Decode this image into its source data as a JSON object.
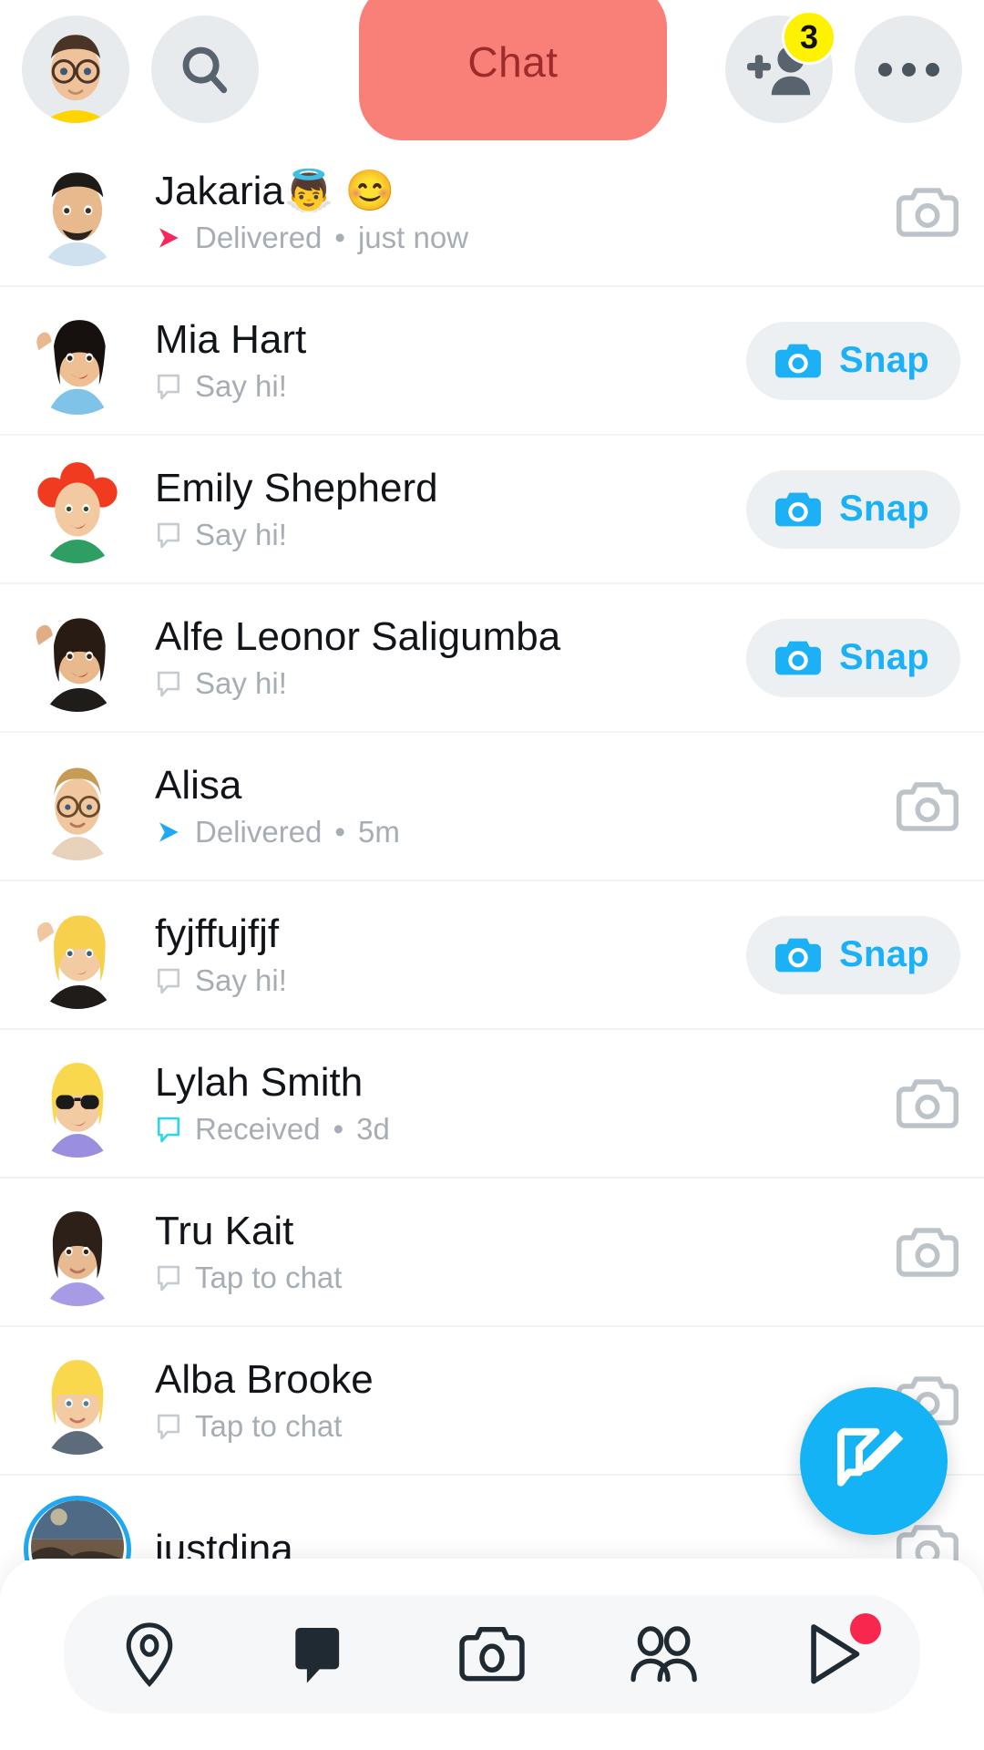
{
  "header": {
    "profile_avatar": "bitmoji-avatar",
    "search_icon": "search-icon",
    "title_pill": {
      "label": "Chat",
      "bg": "#F98079",
      "text_color": "#9E2B2B"
    },
    "add_friend_icon": "add-friend-icon",
    "add_friend_badge": "3",
    "more_icon": "more-options-icon"
  },
  "colors": {
    "snap_blue": "#1CB0F6",
    "fab_blue": "#14B3F5",
    "badge_yellow": "#FFF200",
    "delivered_pink": "#F7275E",
    "delivered_blue": "#1FA9F2",
    "received_cyan": "#2ED6E8",
    "spotlight_red": "#F7274E",
    "muted_text": "#A7ADB4"
  },
  "chats": [
    {
      "name": "Jakaria👼 😊",
      "status": "Delivered",
      "time": "just now",
      "separator": "•",
      "status_icon": "delivered-arrow-icon",
      "status_icon_color": "#F7275E",
      "action": "camera",
      "action_label": "",
      "avatar_style": "bitmoji-male-dark"
    },
    {
      "name": "Mia Hart",
      "status": "Say hi!",
      "time": "",
      "separator": "",
      "status_icon": "chat-bubble-icon",
      "status_icon_color": "#C6CBD0",
      "action": "snap",
      "action_label": "Snap",
      "avatar_style": "bitmoji-black-hair-wave"
    },
    {
      "name": "Emily Shepherd",
      "status": "Say hi!",
      "time": "",
      "separator": "",
      "status_icon": "chat-bubble-icon",
      "status_icon_color": "#C6CBD0",
      "action": "snap",
      "action_label": "Snap",
      "avatar_style": "bitmoji-red-hair"
    },
    {
      "name": "Alfe Leonor Saligumba",
      "status": "Say hi!",
      "time": "",
      "separator": "",
      "status_icon": "chat-bubble-icon",
      "status_icon_color": "#C6CBD0",
      "action": "snap",
      "action_label": "Snap",
      "avatar_style": "bitmoji-brown-hair-wave"
    },
    {
      "name": "Alisa",
      "status": "Delivered",
      "time": "5m",
      "separator": "•",
      "status_icon": "delivered-arrow-icon",
      "status_icon_color": "#1FA9F2",
      "action": "camera",
      "action_label": "",
      "avatar_style": "bitmoji-glasses-blonde"
    },
    {
      "name": "fyjffujfjf",
      "status": "Say hi!",
      "time": "",
      "separator": "",
      "status_icon": "chat-bubble-icon",
      "status_icon_color": "#C6CBD0",
      "action": "snap",
      "action_label": "Snap",
      "avatar_style": "bitmoji-blonde-wave"
    },
    {
      "name": "Lylah Smith",
      "status": "Received",
      "time": "3d",
      "separator": "•",
      "status_icon": "received-bubble-icon",
      "status_icon_color": "#2ED6E8",
      "action": "camera",
      "action_label": "",
      "avatar_style": "bitmoji-sunglasses-blonde"
    },
    {
      "name": "Tru Kait",
      "status": "Tap to chat",
      "time": "",
      "separator": "",
      "status_icon": "chat-bubble-icon",
      "status_icon_color": "#C6CBD0",
      "action": "camera",
      "action_label": "",
      "avatar_style": "bitmoji-dark-hair-purple"
    },
    {
      "name": "Alba Brooke",
      "status": "Tap to chat",
      "time": "",
      "separator": "",
      "status_icon": "chat-bubble-icon",
      "status_icon_color": "#C6CBD0",
      "action": "camera",
      "action_label": "",
      "avatar_style": "bitmoji-blonde-bangs"
    },
    {
      "name": "justdina",
      "status": "",
      "time": "",
      "separator": "",
      "status_icon": "",
      "status_icon_color": "",
      "action": "camera",
      "action_label": "",
      "avatar_style": "photo-story-ring"
    }
  ],
  "fab": {
    "icon": "new-chat-icon"
  },
  "bottom_nav": [
    {
      "icon": "map-pin-icon",
      "active": false,
      "badge": false
    },
    {
      "icon": "chat-icon",
      "active": true,
      "badge": false
    },
    {
      "icon": "camera-icon",
      "active": false,
      "badge": false
    },
    {
      "icon": "friends-icon",
      "active": false,
      "badge": false
    },
    {
      "icon": "spotlight-play-icon",
      "active": false,
      "badge": true
    }
  ]
}
